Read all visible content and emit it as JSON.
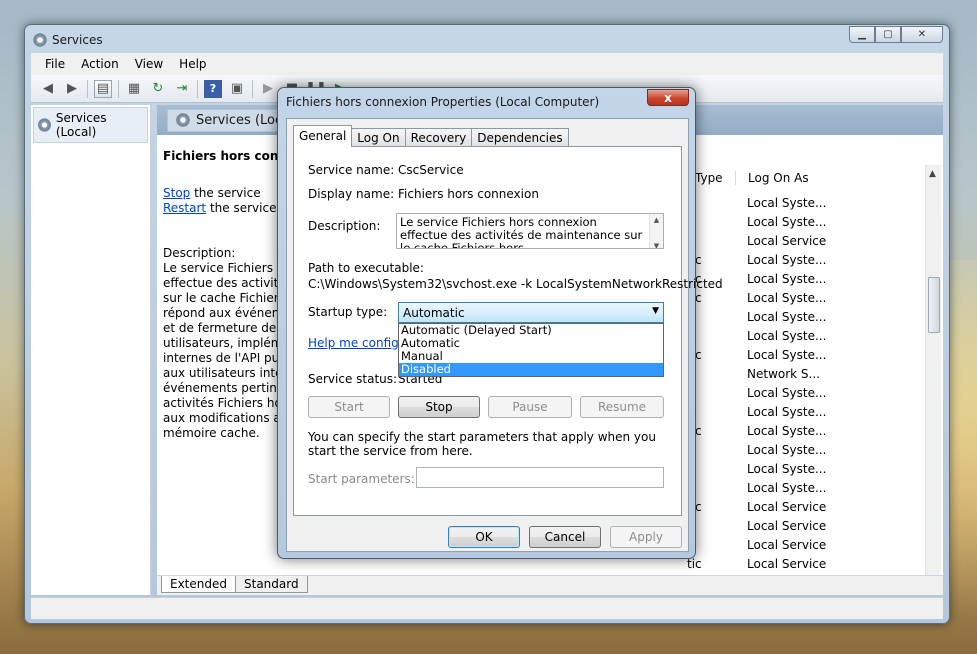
{
  "main_window": {
    "title": "Services",
    "menu": [
      "File",
      "Action",
      "View",
      "Help"
    ],
    "tree_item": "Services (Local)",
    "panel_title": "Services (Local)",
    "selected_service": "Fichiers hors connexion",
    "stop_link": "Stop",
    "stop_rest": " the service",
    "restart_link": "Restart",
    "restart_rest": " the service",
    "description_label": "Description:",
    "description_lines": [
      "Le service Fichiers hors",
      "effectue des activités",
      "sur le cache Fichiers h",
      "répond aux événemer",
      "et de fermeture de ses",
      "utilisateurs, implémer",
      "internes de l'API publi",
      "aux utilisateurs intére",
      "événements pertinent",
      "activités Fichiers hors",
      "aux modifications app",
      "mémoire cache."
    ],
    "columns": {
      "startup_type": "Type",
      "log_on_as": "Log On As"
    },
    "startup_fragments": [
      "",
      "",
      "",
      "tic",
      "tic",
      "tic",
      "",
      "",
      "tic",
      "",
      "",
      "",
      "tic",
      "",
      "",
      "",
      "tic",
      "",
      "",
      "tic",
      "tic",
      ""
    ],
    "log_on_values": [
      "Local Syste...",
      "Local Syste...",
      "Local Service",
      "Local Syste...",
      "Local Syste...",
      "Local Syste...",
      "Local Syste...",
      "Local Syste...",
      "Local Syste...",
      "Network S...",
      "Local Syste...",
      "Local Syste...",
      "Local Syste...",
      "Local Syste...",
      "Local Syste...",
      "Local Syste...",
      "Local Service",
      "Local Service",
      "Local Service",
      "Local Service",
      "Local Service"
    ],
    "bottom_tabs": [
      "Extended",
      "Standard"
    ]
  },
  "dialog": {
    "title": "Fichiers hors connexion Properties (Local Computer)",
    "close_glyph": "x",
    "tabs": [
      "General",
      "Log On",
      "Recovery",
      "Dependencies"
    ],
    "service_name_label": "Service name:",
    "service_name": "CscService",
    "display_name_label": "Display name:",
    "display_name": "Fichiers hors connexion",
    "description_label": "Description:",
    "description": "Le service Fichiers hors connexion effectue des activités de maintenance sur le cache Fichiers hors",
    "path_label": "Path to executable:",
    "path": "C:\\Windows\\System32\\svchost.exe -k LocalSystemNetworkRestricted",
    "startup_type_label": "Startup type:",
    "startup_type_value": "Automatic",
    "startup_options": [
      "Automatic (Delayed Start)",
      "Automatic",
      "Manual",
      "Disabled"
    ],
    "highlighted_option": "Disabled",
    "help_link": "Help me configure s",
    "service_status_label": "Service status:",
    "service_status": "Started",
    "buttons_service": [
      "Start",
      "Stop",
      "Pause",
      "Resume"
    ],
    "params_hint": "You can specify the start parameters that apply when you start the service from here.",
    "start_params_label": "Start parameters:",
    "ok": "OK",
    "cancel": "Cancel",
    "apply": "Apply"
  }
}
